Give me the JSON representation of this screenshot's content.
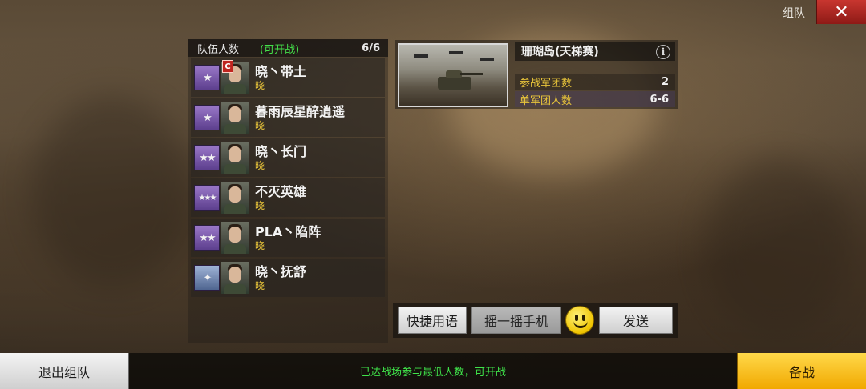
{
  "window": {
    "title": "组队",
    "close_icon": "✕"
  },
  "team": {
    "header_label": "队伍人数",
    "ready_status": "(可开战)",
    "count": "6/6",
    "members": [
      {
        "name": "晓丶带土",
        "guild": "晓",
        "rank": "★",
        "rank_color": "purple",
        "captain": true,
        "captain_label": "C"
      },
      {
        "name": "暮雨辰星醉逍遥",
        "guild": "晓",
        "rank": "★",
        "rank_color": "purple",
        "captain": false
      },
      {
        "name": "晓丶长门",
        "guild": "晓",
        "rank": "★★",
        "rank_color": "purple",
        "captain": false
      },
      {
        "name": "不灭英雄",
        "guild": "晓",
        "rank": "★★★",
        "rank_color": "purple",
        "captain": false
      },
      {
        "name": "PLA丶陷阵",
        "guild": "晓",
        "rank": "★★",
        "rank_color": "purple",
        "captain": false
      },
      {
        "name": "晓丶抚舒",
        "guild": "晓",
        "rank": "✦",
        "rank_color": "blue",
        "captain": false
      }
    ]
  },
  "map": {
    "name": "珊瑚岛(天梯赛)",
    "info_icon": "i",
    "stats": [
      {
        "label": "参战军团数",
        "value": "2"
      },
      {
        "label": "单军团人数",
        "value": "6-6"
      }
    ]
  },
  "chat": {
    "quick_label": "快捷用语",
    "shake_label": "摇一摇手机",
    "send_label": "发送"
  },
  "bottom": {
    "exit_label": "退出组队",
    "status_text": "已达战场参与最低人数，可开战",
    "ready_label": "备战"
  },
  "colors": {
    "accent_yellow": "#f1a800",
    "status_green": "#3fe34a",
    "close_red": "#c8362f",
    "guild_gold": "#e8c43a"
  }
}
